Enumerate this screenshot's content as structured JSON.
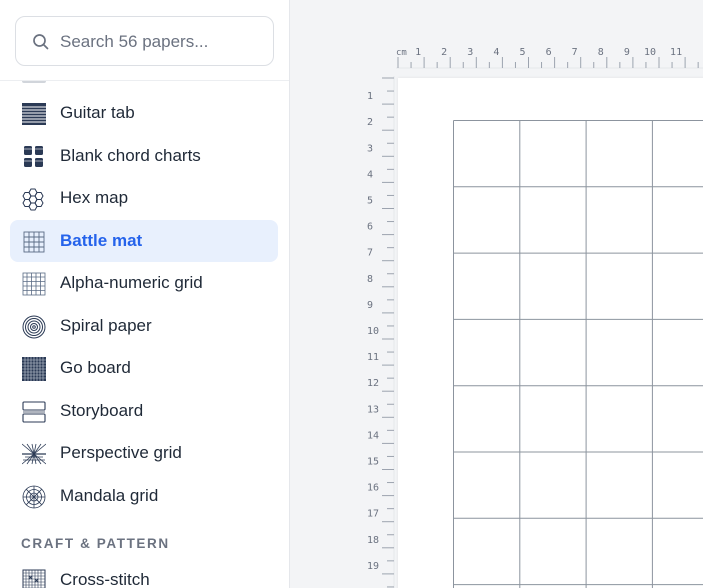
{
  "search": {
    "placeholder": "Search 56 papers..."
  },
  "sidebar": {
    "items": [
      {
        "label": "Guitar tab",
        "icon": "guitar-tab-icon"
      },
      {
        "label": "Blank chord charts",
        "icon": "chord-charts-icon"
      },
      {
        "label": "Hex map",
        "icon": "hex-map-icon"
      },
      {
        "label": "Battle mat",
        "icon": "battle-mat-icon",
        "active": true
      },
      {
        "label": "Alpha-numeric grid",
        "icon": "alpha-numeric-grid-icon"
      },
      {
        "label": "Spiral paper",
        "icon": "spiral-icon"
      },
      {
        "label": "Go board",
        "icon": "go-board-icon"
      },
      {
        "label": "Storyboard",
        "icon": "storyboard-icon"
      },
      {
        "label": "Perspective grid",
        "icon": "perspective-grid-icon"
      },
      {
        "label": "Mandala grid",
        "icon": "mandala-icon"
      }
    ],
    "section_craft": "CRAFT & PATTERN",
    "craft_items": [
      {
        "label": "Cross-stitch",
        "icon": "cross-stitch-icon"
      }
    ]
  },
  "ruler": {
    "unit": "cm",
    "top_labels": [
      "1",
      "2",
      "3",
      "4",
      "5",
      "6",
      "7",
      "8",
      "9",
      "10",
      "11"
    ],
    "left_labels": [
      "1",
      "2",
      "3",
      "4",
      "5",
      "6",
      "7",
      "8",
      "9",
      "10",
      "11",
      "12",
      "13",
      "14",
      "15",
      "16",
      "17",
      "18",
      "19"
    ]
  },
  "colors": {
    "accent": "#2563eb",
    "active_bg": "#e8f0fd",
    "grid_line": "#8c949e"
  }
}
